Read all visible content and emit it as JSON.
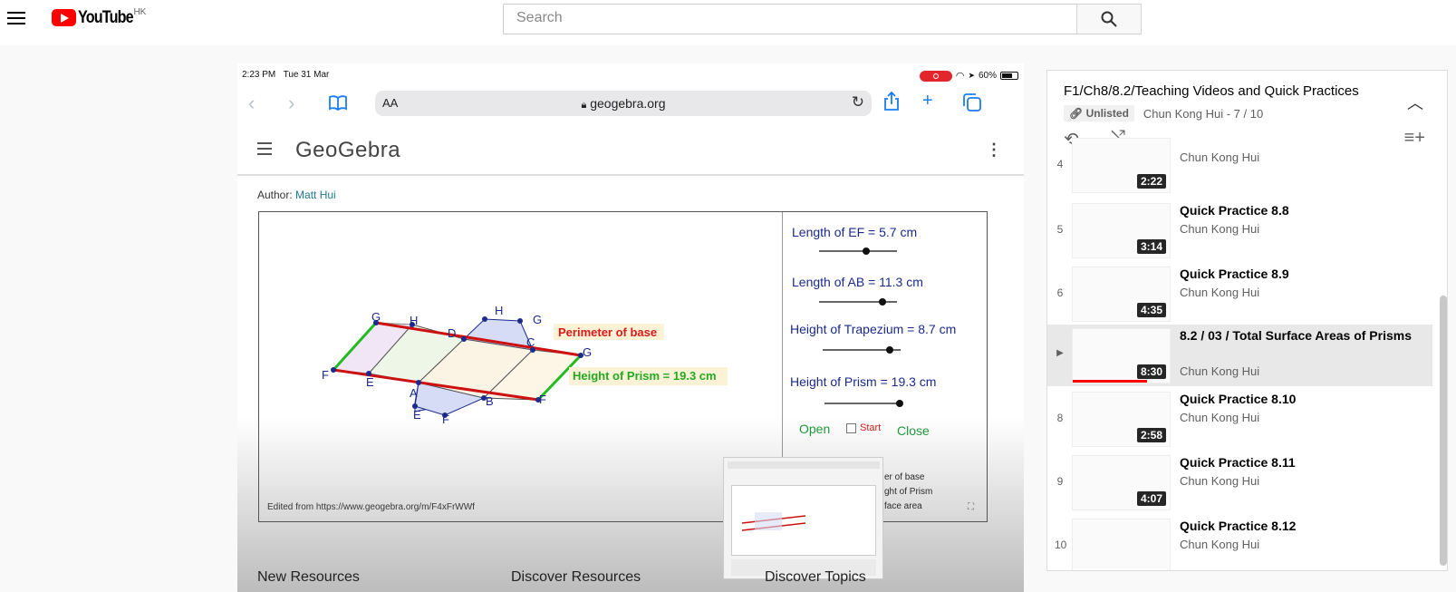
{
  "masthead": {
    "logo_text": "YouTube",
    "country": "HK",
    "search_placeholder": "Search"
  },
  "video": {
    "status_time": "2:23 PM",
    "status_date": "Tue 31 Mar",
    "battery": "60%",
    "url_aa": "AA",
    "url": "geogebra.org",
    "geogebra_logo": "GeoGebra",
    "author_label": "Author:",
    "author_name": "Matt Hui",
    "applet": {
      "sliders": [
        {
          "label": "Length of EF = 5.7 cm",
          "value": 0.61
        },
        {
          "label": "Length of AB = 11.3 cm",
          "value": 0.81
        },
        {
          "label": "Height of Trapezium = 8.7 cm",
          "value": 0.86
        },
        {
          "label": "Height of Prism = 19.3 cm",
          "value": 0.97
        }
      ],
      "open_label": "Open",
      "start_label": "Start",
      "close_label": "Close",
      "perimeter_label": "Perimeter of base",
      "height_label": "Height of Prism = 19.3 cm",
      "vertex_labels": [
        "G",
        "H",
        "D",
        "H",
        "G",
        "C",
        "G",
        "F",
        "E",
        "A",
        "B",
        "F",
        "E",
        "F"
      ],
      "legend_partial": [
        "er of base",
        "ght of Prism",
        "face area"
      ],
      "edited_from": "Edited from https://www.geogebra.org/m/F4xFrWWf"
    },
    "bottom_links": [
      "New Resources",
      "Discover Resources",
      "Discover Topics"
    ]
  },
  "playlist": {
    "title": "F1/Ch8/8.2/Teaching Videos and Quick Practices",
    "visibility": "Unlisted",
    "owner_position": "Chun Kong Hui - 7 / 10",
    "items": [
      {
        "index": "4",
        "title": "",
        "channel": "Chun Kong Hui",
        "duration": "2:22",
        "active": false
      },
      {
        "index": "5",
        "title": "Quick Practice 8.8",
        "channel": "Chun Kong Hui",
        "duration": "3:14",
        "active": false
      },
      {
        "index": "6",
        "title": "Quick Practice 8.9",
        "channel": "Chun Kong Hui",
        "duration": "4:35",
        "active": false
      },
      {
        "index": "▶",
        "title": "8.2 / 03 / Total Surface Areas of Prisms",
        "channel": "Chun Kong Hui",
        "duration": "8:30",
        "active": true
      },
      {
        "index": "8",
        "title": "Quick Practice 8.10",
        "channel": "Chun Kong Hui",
        "duration": "2:58",
        "active": false
      },
      {
        "index": "9",
        "title": "Quick Practice 8.11",
        "channel": "Chun Kong Hui",
        "duration": "4:07",
        "active": false
      },
      {
        "index": "10",
        "title": "Quick Practice 8.12",
        "channel": "Chun Kong Hui",
        "duration": "",
        "active": false
      }
    ]
  },
  "colors": {
    "brand_red": "#ff0000",
    "prism_red": "#cc1111",
    "prism_green": "#22bb22",
    "label_blue": "#1b2a8c"
  }
}
